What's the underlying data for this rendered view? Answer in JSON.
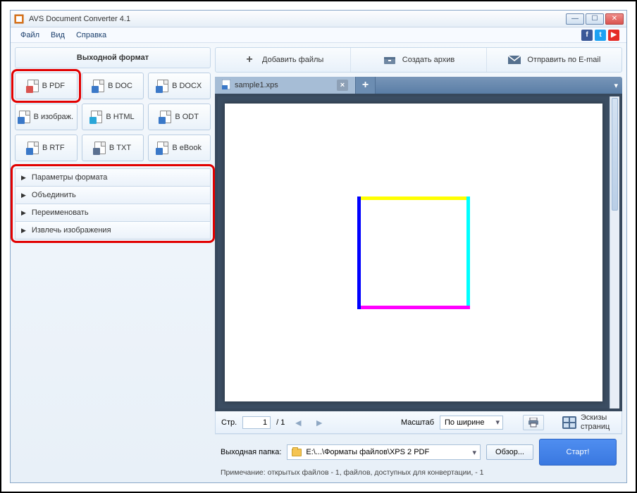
{
  "window": {
    "title": "AVS Document Converter 4.1"
  },
  "menu": {
    "file": "Файл",
    "view": "Вид",
    "help": "Справка"
  },
  "sidebar": {
    "header": "Выходной формат",
    "formats": [
      {
        "label": "В PDF",
        "badge_color": "#d9534f",
        "badge": "P"
      },
      {
        "label": "В DOC",
        "badge_color": "#3a78c8",
        "badge": "W"
      },
      {
        "label": "В DOCX",
        "badge_color": "#3a78c8",
        "badge": "W"
      },
      {
        "label": "В изображ.",
        "badge_color": "#3a78c8",
        "badge": ""
      },
      {
        "label": "В HTML",
        "badge_color": "#2aa6d8",
        "badge": "e"
      },
      {
        "label": "В ODT",
        "badge_color": "#3a78c8",
        "badge": ""
      },
      {
        "label": "В RTF",
        "badge_color": "#3a78c8",
        "badge": "A"
      },
      {
        "label": "В TXT",
        "badge_color": "#5a7090",
        "badge": "A"
      },
      {
        "label": "В eBook",
        "badge_color": "#3a78c8",
        "badge": ""
      }
    ],
    "accordion": [
      "Параметры формата",
      "Объединить",
      "Переименовать",
      "Извлечь изображения"
    ]
  },
  "top_actions": {
    "add": "Добавить файлы",
    "archive": "Создать архив",
    "email": "Отправить по E-mail"
  },
  "tabs": {
    "active": "sample1.xps"
  },
  "pager": {
    "page_label": "Стр.",
    "page_value": "1",
    "page_total": "/ 1",
    "zoom_label": "Масштаб",
    "zoom_value": "По ширине",
    "thumbs": "Эскизы страниц"
  },
  "output": {
    "label": "Выходная папка:",
    "path": "E:\\...\\Форматы файлов\\XPS 2 PDF",
    "browse": "Обзор...",
    "start": "Старт!"
  },
  "note": "Примечание: открытых файлов - 1, файлов, доступных для конвертации, - 1"
}
